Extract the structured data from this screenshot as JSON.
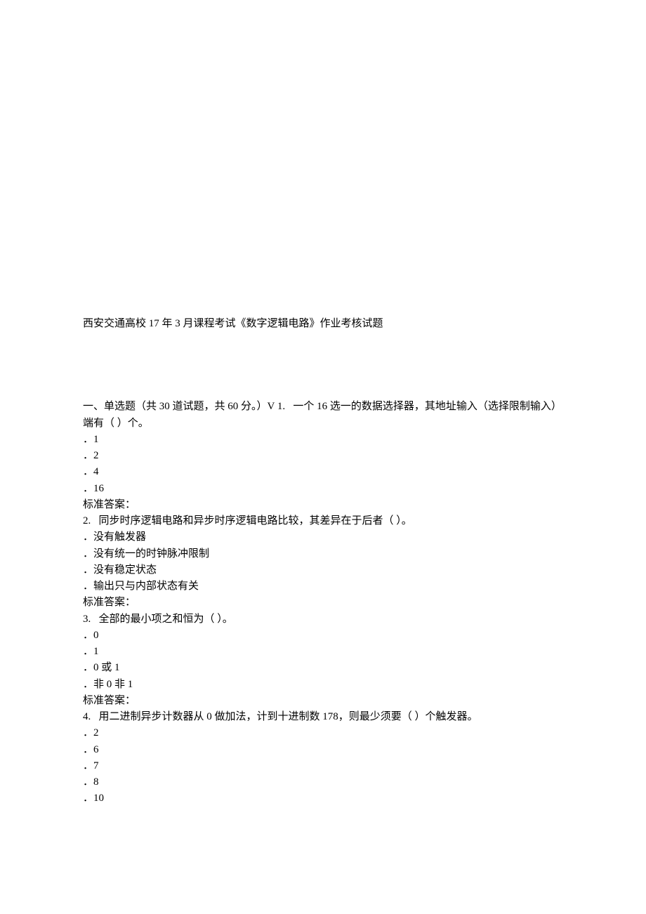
{
  "title": "西安交通高校 17 年 3 月课程考试《数字逻辑电路》作业考核试题",
  "section_intro": "一、单选题（共 30 道试题，共 60 分。）V 1.   一个 16 选一的数据选择器，其地址输入（选择限制输入）端有（ ）个。",
  "q1": {
    "opts": [
      "．1",
      "．2",
      "．4",
      "．16"
    ],
    "answer_label": "标准答案："
  },
  "q2": {
    "stem": "2.   同步时序逻辑电路和异步时序逻辑电路比较，其差异在于后者（ ）。",
    "opts": [
      "．没有触发器",
      "．没有统一的时钟脉冲限制",
      "．没有稳定状态",
      "．输出只与内部状态有关"
    ],
    "answer_label": "标准答案："
  },
  "q3": {
    "stem": "3.   全部的最小项之和恒为（ ）。",
    "opts": [
      "．0",
      "．1",
      "．0 或 1",
      "．非 0 非 1"
    ],
    "answer_label": "标准答案："
  },
  "q4": {
    "stem": "4.   用二进制异步计数器从 0 做加法，计到十进制数 178，则最少须要（ ）个触发器。",
    "opts": [
      "．2",
      "．6",
      "．7",
      "．8",
      "．10"
    ]
  }
}
